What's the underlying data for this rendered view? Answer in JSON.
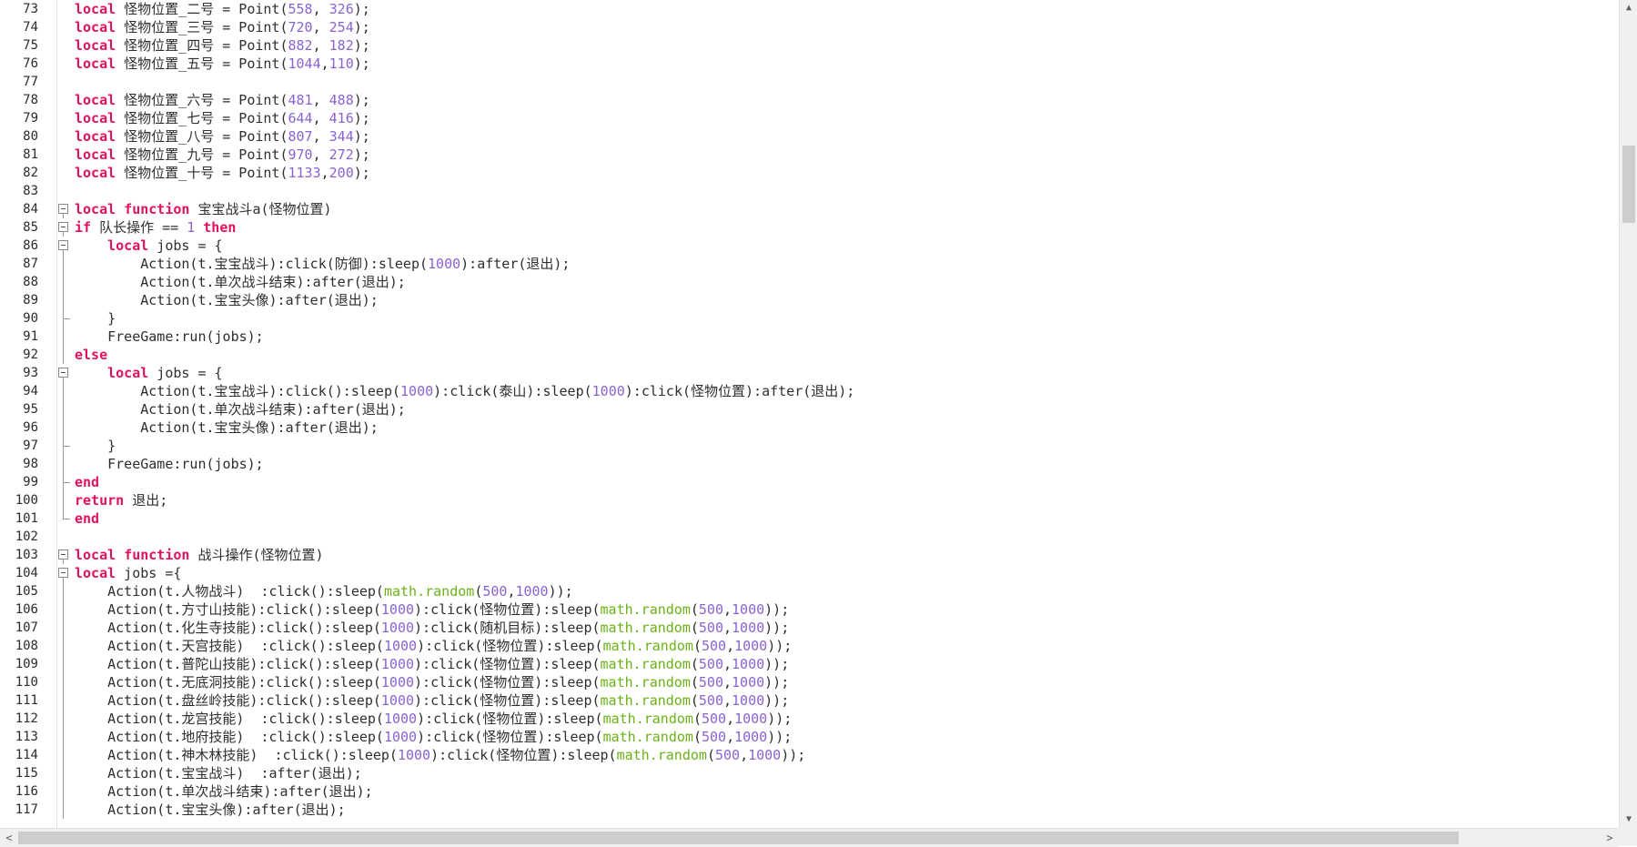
{
  "editor": {
    "lines": [
      {
        "n": "73",
        "fold": "",
        "code": [
          [
            "kw",
            "local"
          ],
          [
            "t",
            " 怪物位置_二号 = Point("
          ],
          [
            "num",
            "558"
          ],
          [
            "t",
            ", "
          ],
          [
            "num",
            "326"
          ],
          [
            "t",
            ");"
          ]
        ]
      },
      {
        "n": "74",
        "fold": "",
        "code": [
          [
            "kw",
            "local"
          ],
          [
            "t",
            " 怪物位置_三号 = Point("
          ],
          [
            "num",
            "720"
          ],
          [
            "t",
            ", "
          ],
          [
            "num",
            "254"
          ],
          [
            "t",
            ");"
          ]
        ]
      },
      {
        "n": "75",
        "fold": "",
        "code": [
          [
            "kw",
            "local"
          ],
          [
            "t",
            " 怪物位置_四号 = Point("
          ],
          [
            "num",
            "882"
          ],
          [
            "t",
            ", "
          ],
          [
            "num",
            "182"
          ],
          [
            "t",
            ");"
          ]
        ]
      },
      {
        "n": "76",
        "fold": "",
        "code": [
          [
            "kw",
            "local"
          ],
          [
            "t",
            " 怪物位置_五号 = Point("
          ],
          [
            "num",
            "1044"
          ],
          [
            "t",
            ","
          ],
          [
            "num",
            "110"
          ],
          [
            "t",
            ");"
          ]
        ]
      },
      {
        "n": "77",
        "fold": "",
        "code": []
      },
      {
        "n": "78",
        "fold": "",
        "code": [
          [
            "kw",
            "local"
          ],
          [
            "t",
            " 怪物位置_六号 = Point("
          ],
          [
            "num",
            "481"
          ],
          [
            "t",
            ", "
          ],
          [
            "num",
            "488"
          ],
          [
            "t",
            ");"
          ]
        ]
      },
      {
        "n": "79",
        "fold": "",
        "code": [
          [
            "kw",
            "local"
          ],
          [
            "t",
            " 怪物位置_七号 = Point("
          ],
          [
            "num",
            "644"
          ],
          [
            "t",
            ", "
          ],
          [
            "num",
            "416"
          ],
          [
            "t",
            ");"
          ]
        ]
      },
      {
        "n": "80",
        "fold": "",
        "code": [
          [
            "kw",
            "local"
          ],
          [
            "t",
            " 怪物位置_八号 = Point("
          ],
          [
            "num",
            "807"
          ],
          [
            "t",
            ", "
          ],
          [
            "num",
            "344"
          ],
          [
            "t",
            ");"
          ]
        ]
      },
      {
        "n": "81",
        "fold": "",
        "code": [
          [
            "kw",
            "local"
          ],
          [
            "t",
            " 怪物位置_九号 = Point("
          ],
          [
            "num",
            "970"
          ],
          [
            "t",
            ", "
          ],
          [
            "num",
            "272"
          ],
          [
            "t",
            ");"
          ]
        ]
      },
      {
        "n": "82",
        "fold": "",
        "code": [
          [
            "kw",
            "local"
          ],
          [
            "t",
            " 怪物位置_十号 = Point("
          ],
          [
            "num",
            "1133"
          ],
          [
            "t",
            ","
          ],
          [
            "num",
            "200"
          ],
          [
            "t",
            ");"
          ]
        ]
      },
      {
        "n": "83",
        "fold": "",
        "code": []
      },
      {
        "n": "84",
        "fold": "box",
        "code": [
          [
            "kw",
            "local"
          ],
          [
            "t",
            " "
          ],
          [
            "kw",
            "function"
          ],
          [
            "t",
            " 宝宝战斗a(怪物位置)"
          ]
        ]
      },
      {
        "n": "85",
        "fold": "box",
        "code": [
          [
            "kw",
            "if"
          ],
          [
            "t",
            " 队长操作 == "
          ],
          [
            "num",
            "1"
          ],
          [
            "t",
            " "
          ],
          [
            "kw",
            "then"
          ]
        ]
      },
      {
        "n": "86",
        "fold": "box",
        "code": [
          [
            "t",
            "    "
          ],
          [
            "kw",
            "local"
          ],
          [
            "t",
            " jobs = {"
          ]
        ]
      },
      {
        "n": "87",
        "fold": "line",
        "code": [
          [
            "t",
            "        Action(t.宝宝战斗):click(防御):sleep("
          ],
          [
            "num",
            "1000"
          ],
          [
            "t",
            "):after(退出);"
          ]
        ]
      },
      {
        "n": "88",
        "fold": "line",
        "code": [
          [
            "t",
            "        Action(t.单次战斗结束):after(退出);"
          ]
        ]
      },
      {
        "n": "89",
        "fold": "line",
        "code": [
          [
            "t",
            "        Action(t.宝宝头像):after(退出);"
          ]
        ]
      },
      {
        "n": "90",
        "fold": "end",
        "code": [
          [
            "t",
            "    }"
          ]
        ]
      },
      {
        "n": "91",
        "fold": "line",
        "code": [
          [
            "t",
            "    FreeGame:run(jobs);"
          ]
        ]
      },
      {
        "n": "92",
        "fold": "line",
        "code": [
          [
            "kw",
            "else"
          ]
        ]
      },
      {
        "n": "93",
        "fold": "box",
        "code": [
          [
            "t",
            "    "
          ],
          [
            "kw",
            "local"
          ],
          [
            "t",
            " jobs = {"
          ]
        ]
      },
      {
        "n": "94",
        "fold": "line",
        "code": [
          [
            "t",
            "        Action(t.宝宝战斗):click():sleep("
          ],
          [
            "num",
            "1000"
          ],
          [
            "t",
            "):click(泰山):sleep("
          ],
          [
            "num",
            "1000"
          ],
          [
            "t",
            "):click(怪物位置):after(退出);"
          ]
        ]
      },
      {
        "n": "95",
        "fold": "line",
        "code": [
          [
            "t",
            "        Action(t.单次战斗结束):after(退出);"
          ]
        ]
      },
      {
        "n": "96",
        "fold": "line",
        "code": [
          [
            "t",
            "        Action(t.宝宝头像):after(退出);"
          ]
        ]
      },
      {
        "n": "97",
        "fold": "end",
        "code": [
          [
            "t",
            "    }"
          ]
        ]
      },
      {
        "n": "98",
        "fold": "line",
        "code": [
          [
            "t",
            "    FreeGame:run(jobs);"
          ]
        ]
      },
      {
        "n": "99",
        "fold": "end",
        "code": [
          [
            "kw",
            "end"
          ]
        ]
      },
      {
        "n": "100",
        "fold": "line",
        "code": [
          [
            "kw",
            "return"
          ],
          [
            "t",
            " 退出;"
          ]
        ]
      },
      {
        "n": "101",
        "fold": "endl",
        "code": [
          [
            "kw",
            "end"
          ]
        ]
      },
      {
        "n": "102",
        "fold": "",
        "code": []
      },
      {
        "n": "103",
        "fold": "box",
        "code": [
          [
            "kw",
            "local"
          ],
          [
            "t",
            " "
          ],
          [
            "kw",
            "function"
          ],
          [
            "t",
            " 战斗操作(怪物位置)"
          ]
        ]
      },
      {
        "n": "104",
        "fold": "box",
        "code": [
          [
            "kw",
            "local"
          ],
          [
            "t",
            " jobs ={"
          ]
        ]
      },
      {
        "n": "105",
        "fold": "line",
        "code": [
          [
            "t",
            "    Action(t.人物战斗)  :click():sleep("
          ],
          [
            "fn",
            "math.random"
          ],
          [
            "t",
            "("
          ],
          [
            "num",
            "500"
          ],
          [
            "t",
            ","
          ],
          [
            "num",
            "1000"
          ],
          [
            "t",
            "));"
          ]
        ]
      },
      {
        "n": "106",
        "fold": "line",
        "code": [
          [
            "t",
            "    Action(t.方寸山技能):click():sleep("
          ],
          [
            "num",
            "1000"
          ],
          [
            "t",
            "):click(怪物位置):sleep("
          ],
          [
            "fn",
            "math.random"
          ],
          [
            "t",
            "("
          ],
          [
            "num",
            "500"
          ],
          [
            "t",
            ","
          ],
          [
            "num",
            "1000"
          ],
          [
            "t",
            "));"
          ]
        ]
      },
      {
        "n": "107",
        "fold": "line",
        "code": [
          [
            "t",
            "    Action(t.化生寺技能):click():sleep("
          ],
          [
            "num",
            "1000"
          ],
          [
            "t",
            "):click(随机目标):sleep("
          ],
          [
            "fn",
            "math.random"
          ],
          [
            "t",
            "("
          ],
          [
            "num",
            "500"
          ],
          [
            "t",
            ","
          ],
          [
            "num",
            "1000"
          ],
          [
            "t",
            "));"
          ]
        ]
      },
      {
        "n": "108",
        "fold": "line",
        "code": [
          [
            "t",
            "    Action(t.天宫技能)  :click():sleep("
          ],
          [
            "num",
            "1000"
          ],
          [
            "t",
            "):click(怪物位置):sleep("
          ],
          [
            "fn",
            "math.random"
          ],
          [
            "t",
            "("
          ],
          [
            "num",
            "500"
          ],
          [
            "t",
            ","
          ],
          [
            "num",
            "1000"
          ],
          [
            "t",
            "));"
          ]
        ]
      },
      {
        "n": "109",
        "fold": "line",
        "code": [
          [
            "t",
            "    Action(t.普陀山技能):click():sleep("
          ],
          [
            "num",
            "1000"
          ],
          [
            "t",
            "):click(怪物位置):sleep("
          ],
          [
            "fn",
            "math.random"
          ],
          [
            "t",
            "("
          ],
          [
            "num",
            "500"
          ],
          [
            "t",
            ","
          ],
          [
            "num",
            "1000"
          ],
          [
            "t",
            "));"
          ]
        ]
      },
      {
        "n": "110",
        "fold": "line",
        "code": [
          [
            "t",
            "    Action(t.无底洞技能):click():sleep("
          ],
          [
            "num",
            "1000"
          ],
          [
            "t",
            "):click(怪物位置):sleep("
          ],
          [
            "fn",
            "math.random"
          ],
          [
            "t",
            "("
          ],
          [
            "num",
            "500"
          ],
          [
            "t",
            ","
          ],
          [
            "num",
            "1000"
          ],
          [
            "t",
            "));"
          ]
        ]
      },
      {
        "n": "111",
        "fold": "line",
        "code": [
          [
            "t",
            "    Action(t.盘丝岭技能):click():sleep("
          ],
          [
            "num",
            "1000"
          ],
          [
            "t",
            "):click(怪物位置):sleep("
          ],
          [
            "fn",
            "math.random"
          ],
          [
            "t",
            "("
          ],
          [
            "num",
            "500"
          ],
          [
            "t",
            ","
          ],
          [
            "num",
            "1000"
          ],
          [
            "t",
            "));"
          ]
        ]
      },
      {
        "n": "112",
        "fold": "line",
        "code": [
          [
            "t",
            "    Action(t.龙宫技能)  :click():sleep("
          ],
          [
            "num",
            "1000"
          ],
          [
            "t",
            "):click(怪物位置):sleep("
          ],
          [
            "fn",
            "math.random"
          ],
          [
            "t",
            "("
          ],
          [
            "num",
            "500"
          ],
          [
            "t",
            ","
          ],
          [
            "num",
            "1000"
          ],
          [
            "t",
            "));"
          ]
        ]
      },
      {
        "n": "113",
        "fold": "line",
        "code": [
          [
            "t",
            "    Action(t.地府技能)  :click():sleep("
          ],
          [
            "num",
            "1000"
          ],
          [
            "t",
            "):click(怪物位置):sleep("
          ],
          [
            "fn",
            "math.random"
          ],
          [
            "t",
            "("
          ],
          [
            "num",
            "500"
          ],
          [
            "t",
            ","
          ],
          [
            "num",
            "1000"
          ],
          [
            "t",
            "));"
          ]
        ]
      },
      {
        "n": "114",
        "fold": "line",
        "code": [
          [
            "t",
            "    Action(t.神木林技能)  :click():sleep("
          ],
          [
            "num",
            "1000"
          ],
          [
            "t",
            "):click(怪物位置):sleep("
          ],
          [
            "fn",
            "math.random"
          ],
          [
            "t",
            "("
          ],
          [
            "num",
            "500"
          ],
          [
            "t",
            ","
          ],
          [
            "num",
            "1000"
          ],
          [
            "t",
            "));"
          ]
        ]
      },
      {
        "n": "115",
        "fold": "line",
        "code": [
          [
            "t",
            "    Action(t.宝宝战斗)  :after(退出);"
          ]
        ]
      },
      {
        "n": "116",
        "fold": "line",
        "code": [
          [
            "t",
            "    Action(t.单次战斗结束):after(退出);"
          ]
        ]
      },
      {
        "n": "117",
        "fold": "line",
        "code": [
          [
            "t",
            "    Action(t.宝宝头像):after(退出);"
          ]
        ]
      }
    ]
  },
  "scrollbars": {
    "up_arrow": "▲",
    "down_arrow": "▼",
    "left_arrow": "<",
    "right_arrow": ">"
  },
  "colors": {
    "keyword": "#e0115f",
    "number": "#8a63d2",
    "builtin": "#6ab216",
    "text": "#2e2e2e"
  }
}
